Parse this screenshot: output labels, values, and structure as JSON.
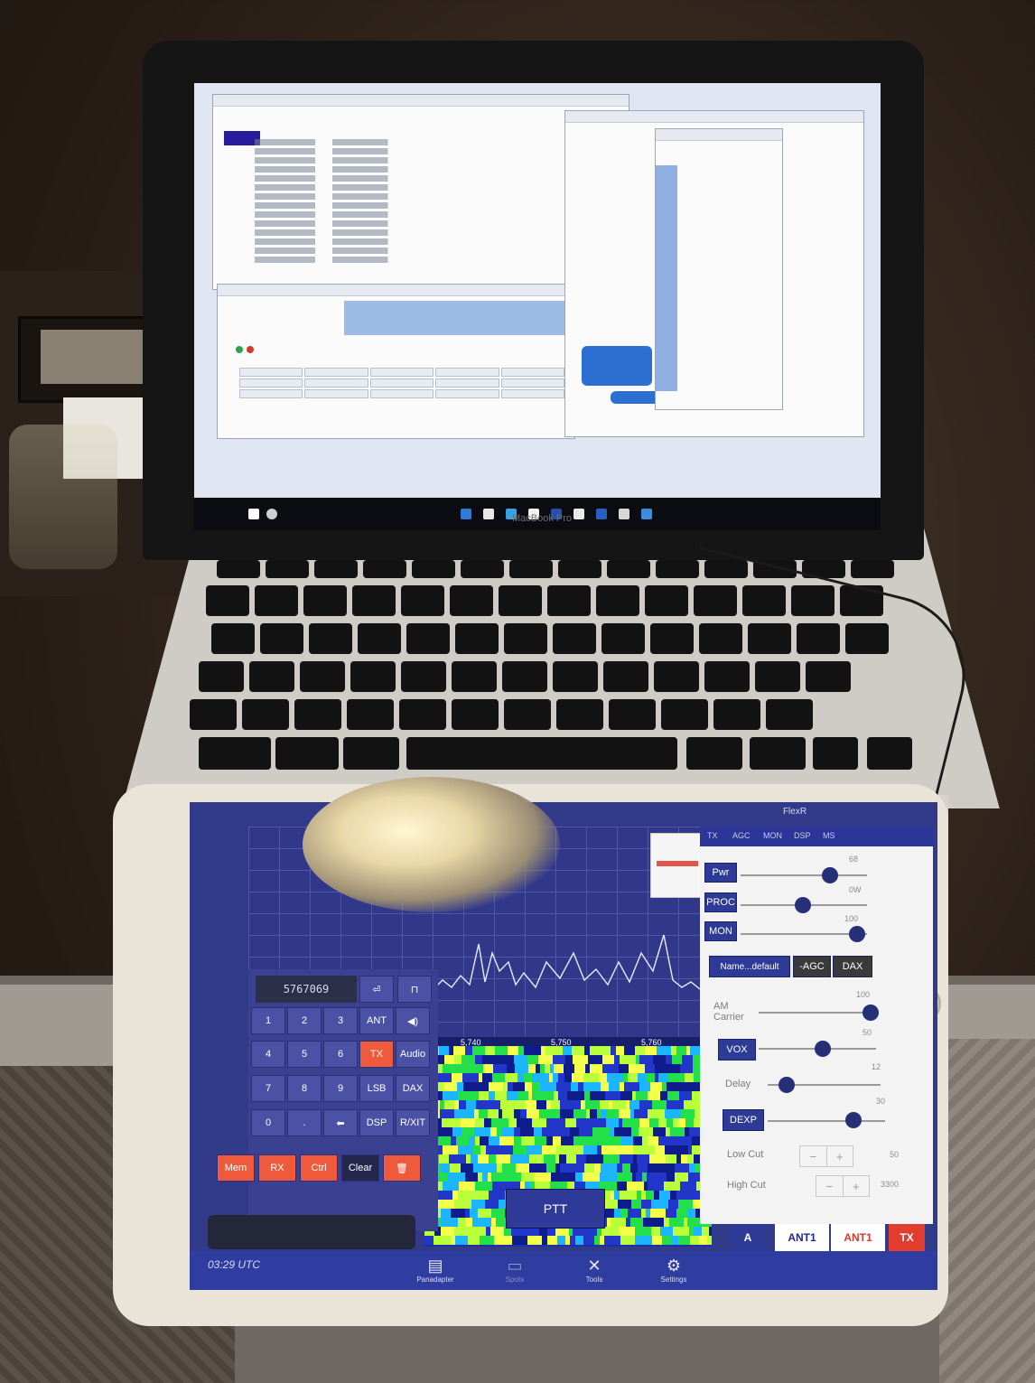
{
  "laptop": {
    "brand_label": "MacBook Pro",
    "windows_count": 5
  },
  "ipad_app": {
    "status_bar": {
      "title": "FlexR"
    },
    "keypad": {
      "display": "5767069",
      "digit_keys": [
        "1",
        "2",
        "3",
        "4",
        "5",
        "6",
        "7",
        "8",
        "9",
        "0",
        "."
      ],
      "side_keys": [
        "ANT",
        "TX",
        "Audio",
        "LSB",
        "DAX",
        "DSP",
        "R/XIT"
      ],
      "red_keys": [
        "Mem",
        "RX",
        "Ctrl"
      ],
      "clear_label": "Clear"
    },
    "waterfall": {
      "ruler_ticks": [
        "5,740",
        "5,750",
        "5,760"
      ],
      "ptt_label": "PTT"
    },
    "right_panel": {
      "tabs": [
        "TX",
        "AGC",
        "MON",
        "DSP",
        "MS"
      ],
      "buttons": {
        "pwr": "Pwr",
        "proc": "PROC",
        "mon": "MON",
        "preset": "Name...default",
        "agc": "-AGC",
        "dax": "DAX",
        "vox": "VOX",
        "dexp": "DEXP"
      },
      "labels": {
        "am_carrier": "AM Carrier",
        "delay": "Delay",
        "low_cut": "Low Cut",
        "high_cut": "High Cut"
      },
      "values": {
        "pwr": "68",
        "proc": "0W",
        "mon": "100",
        "am_carrier": "100",
        "vox": "50",
        "delay": "12",
        "dexp": "30",
        "low_cut": "50",
        "high_cut": "3300"
      },
      "stepper_minus": "−",
      "stepper_plus": "+"
    },
    "status_row": {
      "a_label": "A",
      "ant_label": "ANT1",
      "rx_ant_label": "ANT1",
      "tx_label": "TX"
    },
    "bottom_bar": {
      "utc": "03:29 UTC",
      "nav": [
        {
          "label": "Panadapter",
          "icon": "panadapter-icon"
        },
        {
          "label": "Spots",
          "icon": "spots-icon"
        },
        {
          "label": "Tools",
          "icon": "tools-icon"
        },
        {
          "label": "Settings",
          "icon": "settings-icon"
        }
      ]
    }
  },
  "colors": {
    "app_blue": "#323a8a",
    "accent_red": "#f05a3c",
    "panel_bg": "#f3f3f3"
  }
}
